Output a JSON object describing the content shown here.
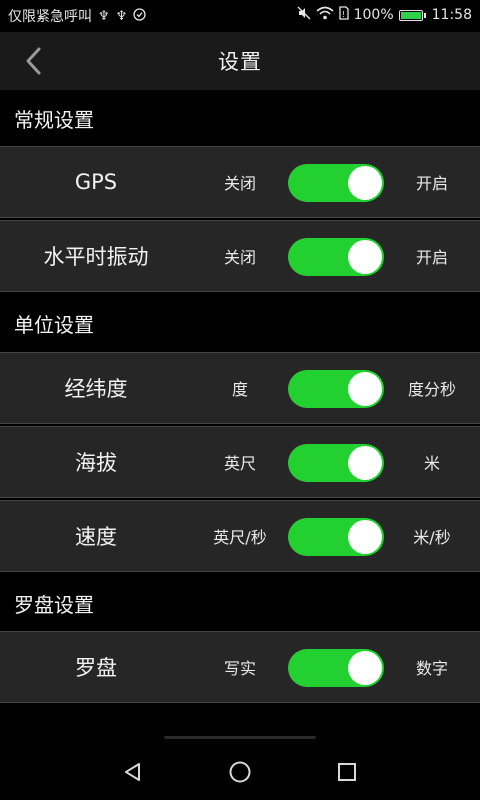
{
  "status_bar": {
    "carrier_text": "仅限紧急呼叫",
    "battery_percent": "100%",
    "time": "11:58",
    "icons_left": [
      "usb-icon",
      "usb-icon",
      "sync-icon"
    ],
    "icons_right": [
      "mute-icon",
      "wifi-icon",
      "sim-icon",
      "battery-icon"
    ]
  },
  "header": {
    "title": "设置",
    "back_icon": "chevron-left-icon"
  },
  "sections": [
    {
      "title": "常规设置",
      "rows": [
        {
          "label": "GPS",
          "left_option": "关闭",
          "right_option": "开启",
          "toggle_on": true
        },
        {
          "label": "水平时振动",
          "left_option": "关闭",
          "right_option": "开启",
          "toggle_on": true
        }
      ]
    },
    {
      "title": "单位设置",
      "rows": [
        {
          "label": "经纬度",
          "left_option": "度",
          "right_option": "度分秒",
          "toggle_on": true
        },
        {
          "label": "海拔",
          "left_option": "英尺",
          "right_option": "米",
          "toggle_on": true
        },
        {
          "label": "速度",
          "left_option": "英尺/秒",
          "right_option": "米/秒",
          "toggle_on": true
        }
      ]
    },
    {
      "title": "罗盘设置",
      "rows": [
        {
          "label": "罗盘",
          "left_option": "写实",
          "right_option": "数字",
          "toggle_on": true
        }
      ]
    }
  ],
  "nav_bar": {
    "buttons": [
      "back-triangle-icon",
      "home-circle-icon",
      "recents-square-icon"
    ]
  },
  "colors": {
    "toggle_on": "#22d12f",
    "row_background": "#262626",
    "header_background": "#1a1a1a"
  }
}
